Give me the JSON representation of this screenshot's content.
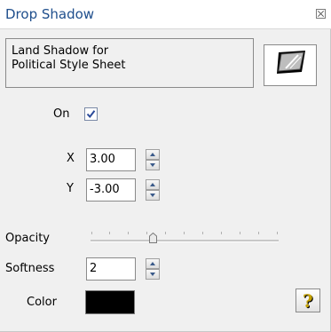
{
  "window": {
    "title": "Drop Shadow",
    "close_icon": "close-box-icon"
  },
  "description": {
    "line1": "Land Shadow for",
    "line2": "Political Style Sheet",
    "preview_icon": "shadow-preview-icon"
  },
  "on": {
    "label": "On",
    "checked": true
  },
  "x": {
    "label": "X",
    "value": "3.00"
  },
  "y": {
    "label": "Y",
    "value": "-3.00"
  },
  "opacity": {
    "label": "Opacity",
    "value_fraction": 0.33
  },
  "softness": {
    "label": "Softness",
    "value": "2"
  },
  "color": {
    "label": "Color",
    "value": "#000000"
  },
  "help": {
    "glyph": "?",
    "icon": "help-icon"
  },
  "colors": {
    "title_text": "#1e4e8c",
    "background": "#f0f0f0"
  }
}
